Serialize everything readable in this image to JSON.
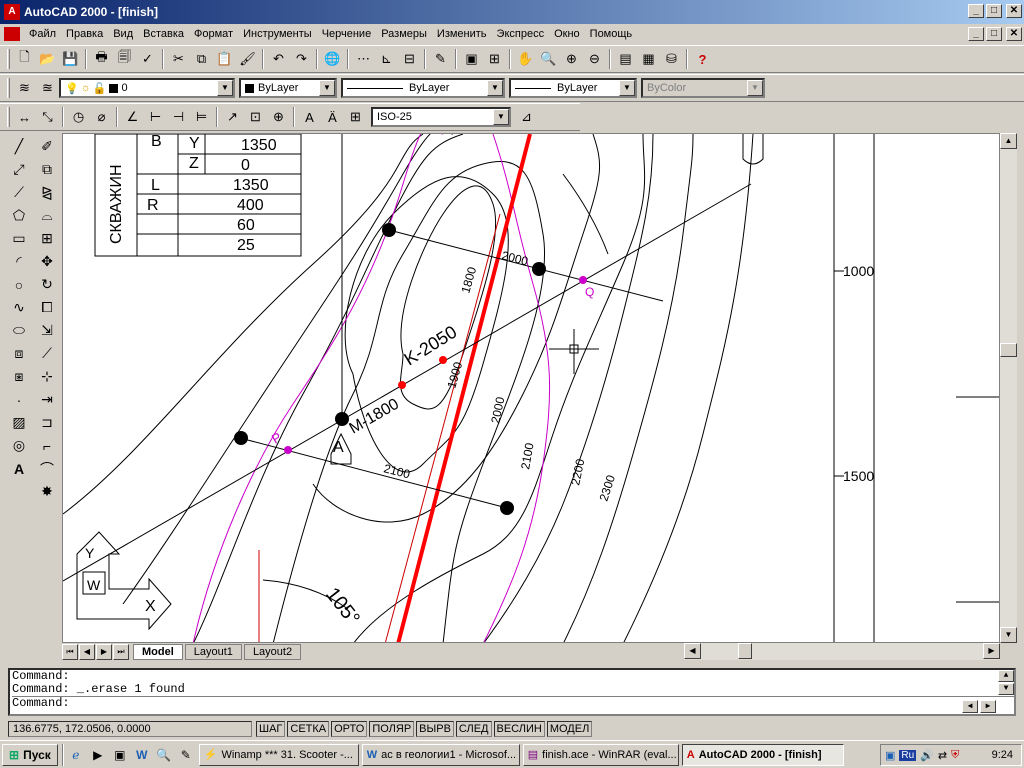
{
  "window": {
    "title": "AutoCAD 2000 - [finish]",
    "app_icon": "A",
    "buttons": [
      "_",
      "□",
      "✕"
    ]
  },
  "menu": [
    "Файл",
    "Правка",
    "Вид",
    "Вставка",
    "Формат",
    "Инструменты",
    "Черчение",
    "Размеры",
    "Изменить",
    "Экспресс",
    "Окно",
    "Помощь"
  ],
  "properties": {
    "layer": "0",
    "color": "ByLayer",
    "linetype": "ByLayer",
    "lineweight": "ByLayer",
    "plotstyle": "ByColor"
  },
  "dim_style": "ISO-25",
  "drawing": {
    "table": [
      [
        "В",
        "Y",
        "1350"
      ],
      [
        "",
        "Z",
        "0"
      ],
      [
        "",
        "L",
        "1350"
      ],
      [
        "",
        "R",
        "400"
      ],
      [
        "",
        "",
        "60"
      ],
      [
        "",
        "",
        "25"
      ]
    ],
    "table_vertical": "СКВАЖИН",
    "labels": {
      "k2050": "K-2050",
      "m1800": "M-1800",
      "a": "A",
      "p": "P",
      "q": "Q",
      "angle": "105°",
      "c1800": "1800",
      "c1900": "1900",
      "c2000a": "2000",
      "c2000b": "2000",
      "c2100a": "2100",
      "c2100b": "2100",
      "c2200": "2200",
      "c2300": "2300",
      "y1000": "1000",
      "y1500": "1500",
      "ucs_y": "Y",
      "ucs_w": "W",
      "ucs_x": "X"
    }
  },
  "tabs": [
    "Model",
    "Layout1",
    "Layout2"
  ],
  "command": {
    "lines": [
      "Command:",
      "Command: _.erase 1 found"
    ],
    "prompt": "Command:"
  },
  "status": {
    "coords": "136.6775, 172.0506, 0.0000",
    "modes": [
      "ШАГ",
      "СЕТКА",
      "ОРТО",
      "ПОЛЯР",
      "ВЫРВ",
      "СЛЕД",
      "ВЕСЛИН",
      "МОДЕЛ"
    ]
  },
  "taskbar": {
    "start": "Пуск",
    "tasks": [
      "Winamp *** 31. Scooter -...",
      "ас в геологии1 - Microsof...",
      "finish.ace - WinRAR (eval...",
      "AutoCAD 2000 - [finish]"
    ],
    "lang": "Ru",
    "time": "9:24"
  },
  "colors": {
    "title_start": "#0a246a",
    "title_end": "#a6caf0",
    "fault": "#ff0000",
    "magenta": "#cc00cc"
  }
}
